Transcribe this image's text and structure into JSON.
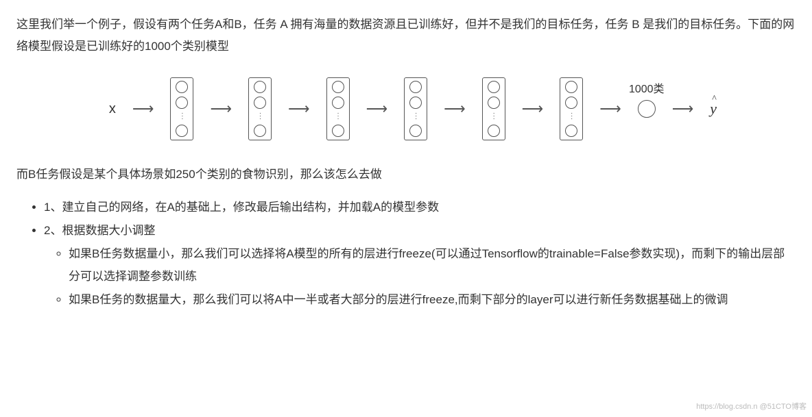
{
  "intro": "这里我们举一个例子，假设有两个任务A和B，任务 A 拥有海量的数据资源且已训练好，但并不是我们的目标任务，任务 B 是我们的目标任务。下面的网络模型假设是已训练好的1000个类别模型",
  "diagram": {
    "input": "x",
    "output_label": "1000类",
    "output": "ŷ"
  },
  "para2": "而B任务假设是某个具体场景如250个类别的食物识别，那么该怎么去做",
  "list": {
    "item1": "1、建立自己的网络，在A的基础上，修改最后输出结构，并加载A的模型参数",
    "item2": "2、根据数据大小调整",
    "sub1": "如果B任务数据量小，那么我们可以选择将A模型的所有的层进行freeze(可以通过Tensorflow的trainable=False参数实现)，而剩下的输出层部分可以选择调整参数训练",
    "sub2": "如果B任务的数据量大，那么我们可以将A中一半或者大部分的层进行freeze,而剩下部分的layer可以进行新任务数据基础上的微调"
  },
  "watermark": "https://blog.csdn.n @51CTO博客"
}
